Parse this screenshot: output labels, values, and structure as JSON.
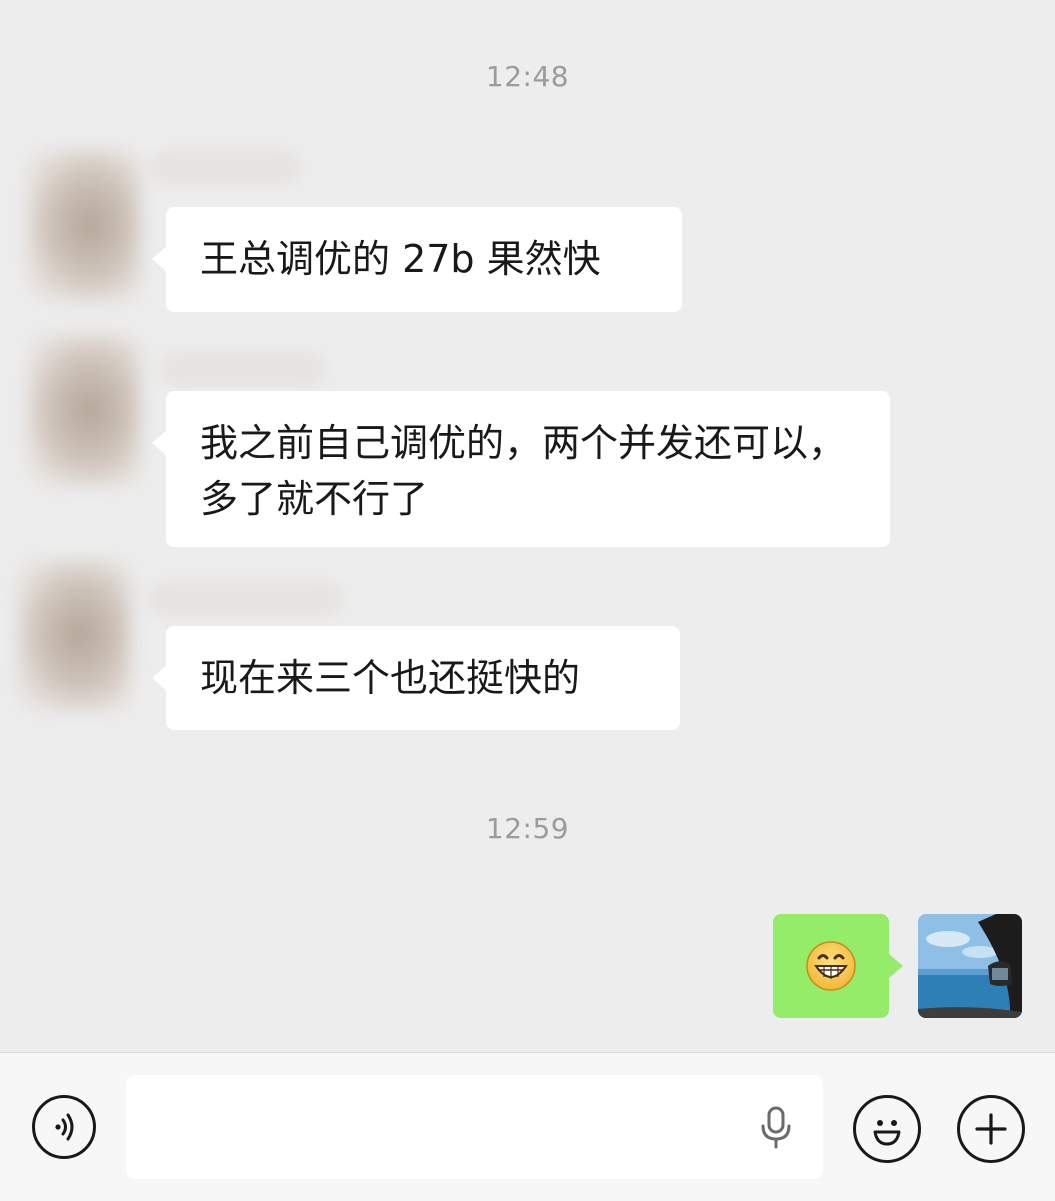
{
  "chat": {
    "timestamp_1": "12:48",
    "timestamp_2": "12:59",
    "messages": [
      {
        "text": "王总调优的 27b 果然快"
      },
      {
        "text": "我之前自己调优的，两个并发还可以，多了就不行了"
      },
      {
        "text": "现在来三个也还挺快的"
      }
    ],
    "outgoing_emoji": "😁"
  },
  "input_bar": {
    "text_value": "",
    "voice_icon": "voice-icon",
    "mic_icon": "microphone-icon",
    "emoji_icon": "smiley-icon",
    "more_icon": "plus-icon"
  },
  "colors": {
    "background": "#ededed",
    "incoming_bubble": "#ffffff",
    "outgoing_bubble": "#95ec69",
    "timestamp_text": "#9b9b9b"
  }
}
